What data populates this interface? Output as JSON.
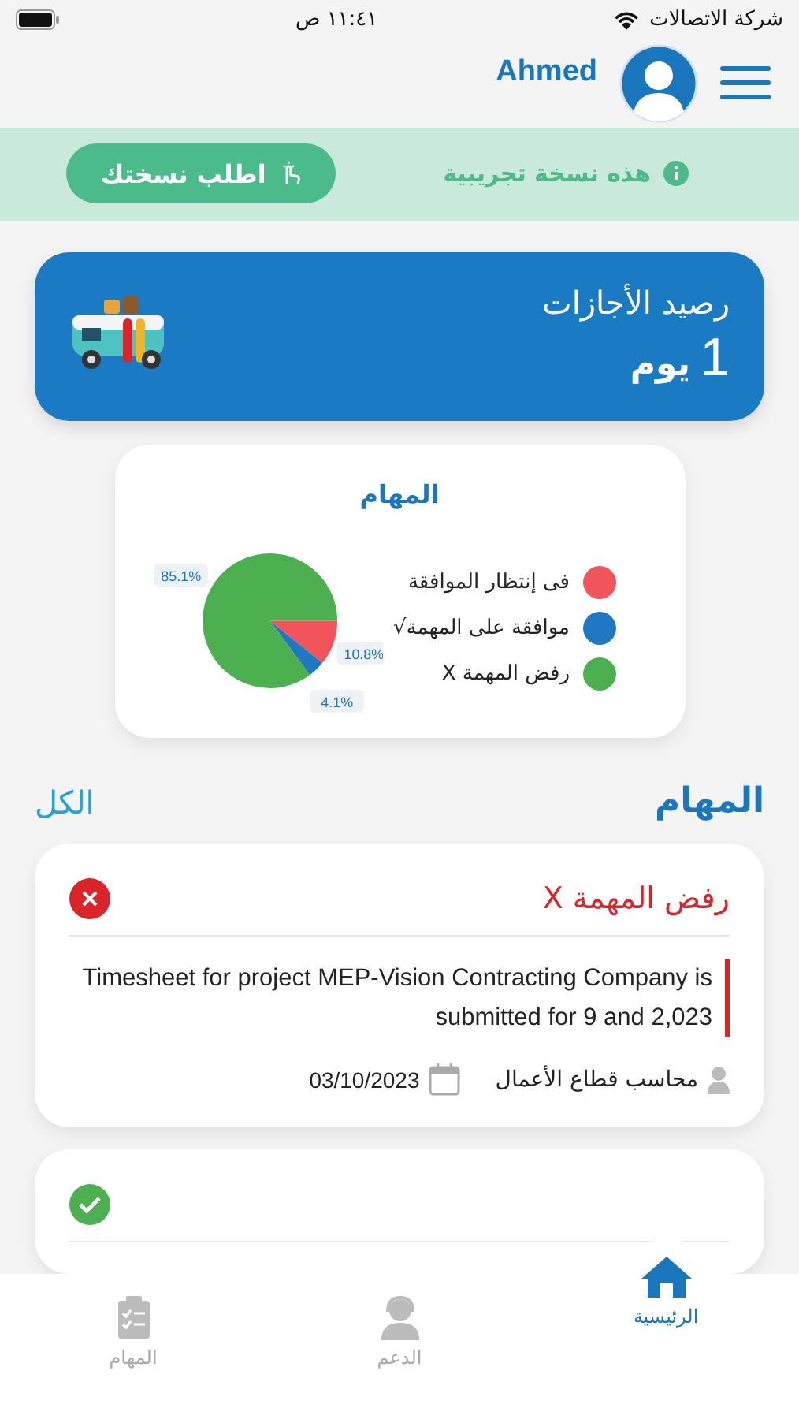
{
  "status_bar": {
    "carrier": "شركة الاتصالات",
    "time": "١١:٤١ ص"
  },
  "header": {
    "user_name": "Ahmed"
  },
  "trial_banner": {
    "message": "هذه نسخة تجريبية",
    "button": "اطلب نسختك"
  },
  "leave_balance": {
    "title": "رصيد الأجازات",
    "value": "1",
    "unit": "يوم"
  },
  "tasks_chart": {
    "title": "المهام",
    "legend": [
      {
        "color": "#f2545b"
      },
      {
        "color": "#1f78c1"
      },
      {
        "color": "#4caf50"
      }
    ],
    "chart_data": {
      "type": "pie",
      "categories": [
        "فى إنتظار الموافقة",
        "موافقة على المهمة√",
        "رفض المهمة X"
      ],
      "values": [
        10.8,
        4.1,
        85.1
      ],
      "value_labels": [
        "10.8%",
        "4.1%",
        "85.1%"
      ]
    }
  },
  "tasks_section": {
    "title": "المهام",
    "see_all": "الكل"
  },
  "tasks": [
    {
      "kind": "rejected",
      "title": "رفض المهمة X",
      "description": "Timesheet for project  MEP-Vision Contracting Company is submitted for 9 and 2,023",
      "assignee": "محاسب قطاع الأعمال",
      "date": "03/10/2023"
    },
    {
      "kind": "approved"
    }
  ],
  "bottom_nav": [
    {
      "kind": "home",
      "label": "الرئيسية",
      "selected": true
    },
    {
      "kind": "support",
      "label": "الدعم",
      "selected": false
    },
    {
      "kind": "tasks",
      "label": "المهام",
      "selected": false
    }
  ]
}
